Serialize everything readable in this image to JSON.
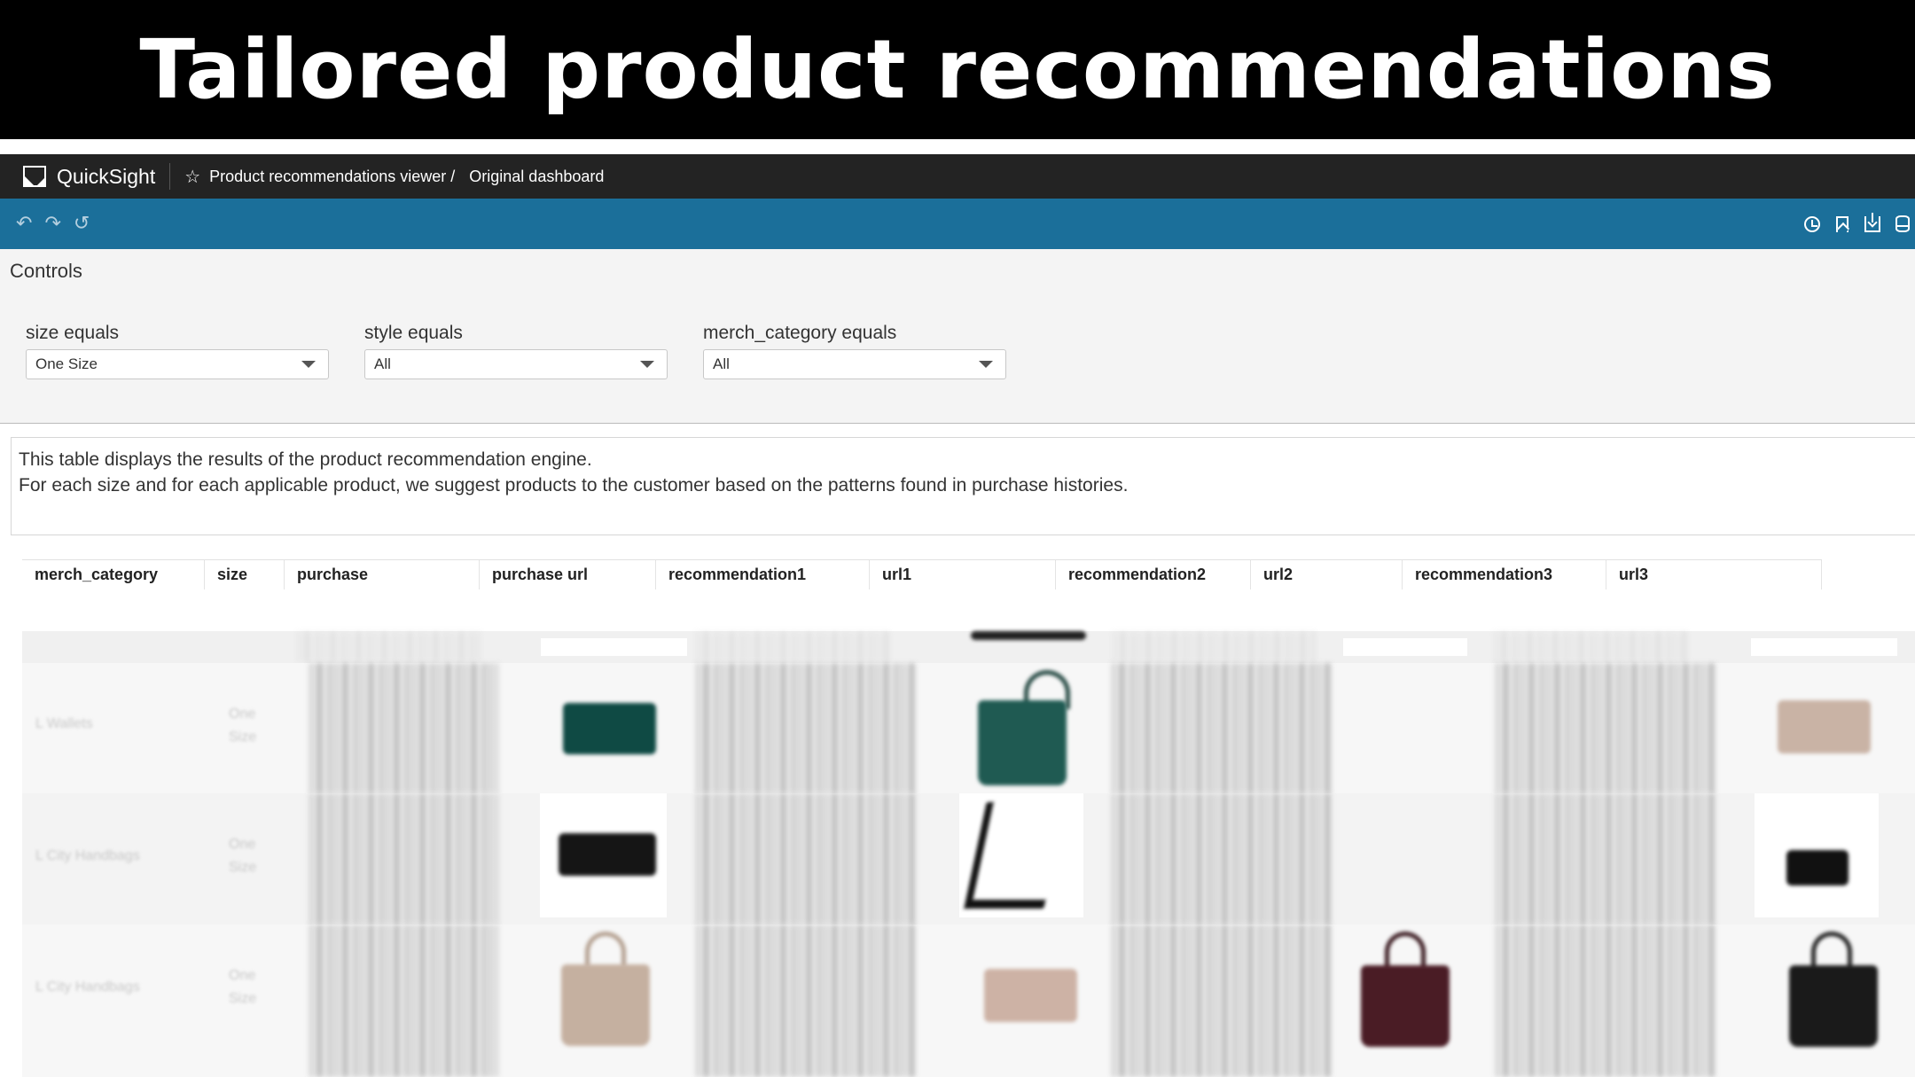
{
  "banner": {
    "title": "Tailored product recommendations"
  },
  "app": {
    "name": "QuickSight",
    "breadcrumb": {
      "parent": "Product recommendations viewer /",
      "current": "Original dashboard"
    }
  },
  "toolbar": {
    "left_icons": [
      "undo-icon",
      "redo-icon",
      "reset-icon"
    ],
    "right_icons": [
      "clock-icon",
      "bookmark-icon",
      "download-icon",
      "dataset-icon"
    ],
    "accent_color": "#1b6f9a"
  },
  "controls": {
    "title": "Controls",
    "filters": [
      {
        "label": "size equals",
        "value": "One Size"
      },
      {
        "label": "style equals",
        "value": "All"
      },
      {
        "label": "merch_category equals",
        "value": "All"
      }
    ]
  },
  "description": {
    "line1": "This table displays the results of the product recommendation engine.",
    "line2": "For each size and for each applicable product, we suggest products to the customer based on the patterns found in purchase histories."
  },
  "table": {
    "columns": [
      "merch_category",
      "size",
      "purchase",
      "purchase url",
      "recommendation1",
      "url1",
      "recommendation2",
      "url2",
      "recommendation3",
      "url3"
    ],
    "rows": [
      {
        "merch_category": "L Wallets",
        "size": "One Size"
      },
      {
        "merch_category": "L City Handbags",
        "size": "One Size"
      },
      {
        "merch_category": "L City Handbags",
        "size": "One Size"
      }
    ]
  }
}
